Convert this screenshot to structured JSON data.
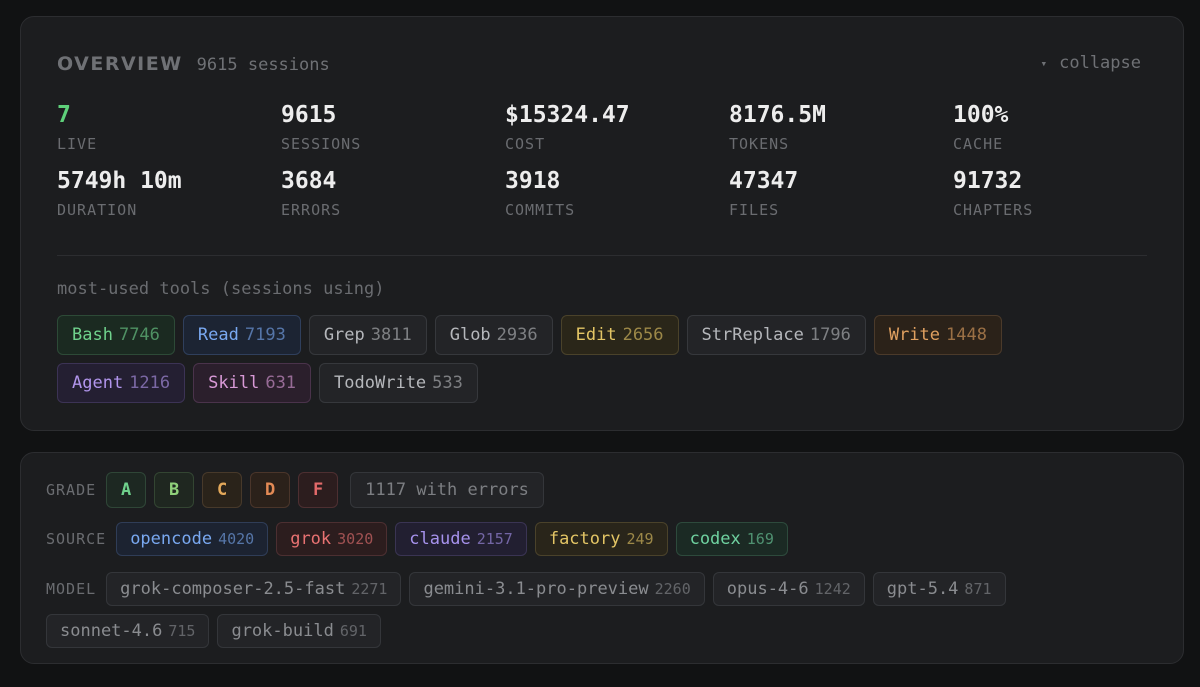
{
  "overview": {
    "title": "OVERVIEW",
    "session_count": "9615 sessions",
    "collapse_label": "collapse",
    "collapse_icon": "triangle-down-icon",
    "stats": [
      {
        "value": "7",
        "label": "LIVE",
        "color": "#5ed07a"
      },
      {
        "value": "9615",
        "label": "SESSIONS"
      },
      {
        "value": "$15324.47",
        "label": "COST"
      },
      {
        "value": "8176.5M",
        "label": "TOKENS"
      },
      {
        "value": "100%",
        "label": "CACHE"
      },
      {
        "value": "5749h 10m",
        "label": "DURATION"
      },
      {
        "value": "3684",
        "label": "ERRORS"
      },
      {
        "value": "3918",
        "label": "COMMITS"
      },
      {
        "value": "47347",
        "label": "FILES"
      },
      {
        "value": "91732",
        "label": "CHAPTERS"
      }
    ],
    "tools_label": "most-used tools (sessions using)",
    "tools": [
      {
        "name": "Bash",
        "count": "7746",
        "color": "#6fd18c",
        "bg": "#1b2a21",
        "border": "#2d4a37"
      },
      {
        "name": "Read",
        "count": "7193",
        "color": "#79a8f0",
        "bg": "#1c2433",
        "border": "#2f3f5c"
      },
      {
        "name": "Grep",
        "count": "3811",
        "color": "#b5b7bb",
        "bg": "#232427",
        "border": "#36383c"
      },
      {
        "name": "Glob",
        "count": "2936",
        "color": "#b5b7bb",
        "bg": "#232427",
        "border": "#36383c"
      },
      {
        "name": "Edit",
        "count": "2656",
        "color": "#e3c565",
        "bg": "#2a2619",
        "border": "#4a422a"
      },
      {
        "name": "StrReplace",
        "count": "1796",
        "color": "#b5b7bb",
        "bg": "#232427",
        "border": "#36383c"
      },
      {
        "name": "Write",
        "count": "1448",
        "color": "#e0a060",
        "bg": "#2b2219",
        "border": "#4b3a2a"
      },
      {
        "name": "Agent",
        "count": "1216",
        "color": "#b195ec",
        "bg": "#241f32",
        "border": "#3c3355"
      },
      {
        "name": "Skill",
        "count": "631",
        "color": "#d99ad7",
        "bg": "#2b1f2c",
        "border": "#4a334b"
      },
      {
        "name": "TodoWrite",
        "count": "533",
        "color": "#b5b7bb",
        "bg": "#232427",
        "border": "#36383c"
      }
    ]
  },
  "filters": {
    "grade_label": "GRADE",
    "grades": [
      {
        "letter": "A",
        "color": "#6fd18c",
        "bg": "#1d2822",
        "border": "#2f4637"
      },
      {
        "letter": "B",
        "color": "#8fd07a",
        "bg": "#1f2720",
        "border": "#334532"
      },
      {
        "letter": "C",
        "color": "#e3a85a",
        "bg": "#2a231a",
        "border": "#47392a"
      },
      {
        "letter": "D",
        "color": "#e38a55",
        "bg": "#2b211a",
        "border": "#4a352a"
      },
      {
        "letter": "F",
        "color": "#e36a6a",
        "bg": "#2c1d1e",
        "border": "#4d2f31"
      }
    ],
    "errors_chip": "1117 with errors",
    "source_label": "SOURCE",
    "sources": [
      {
        "name": "opencode",
        "count": "4020",
        "color": "#79a8f0",
        "bg": "#1c2331",
        "border": "#2f3d57"
      },
      {
        "name": "grok",
        "count": "3020",
        "color": "#e87272",
        "bg": "#2c1d1e",
        "border": "#4c2f31"
      },
      {
        "name": "claude",
        "count": "2157",
        "color": "#a692ec",
        "bg": "#221f31",
        "border": "#3a3453"
      },
      {
        "name": "factory",
        "count": "249",
        "color": "#e3c565",
        "bg": "#29251a",
        "border": "#4a422a"
      },
      {
        "name": "codex",
        "count": "169",
        "color": "#6fd1a0",
        "bg": "#1b2a24",
        "border": "#2d4a3c"
      }
    ],
    "model_label": "MODEL",
    "models": [
      {
        "name": "grok-composer-2.5-fast",
        "count": "2271"
      },
      {
        "name": "gemini-3.1-pro-preview",
        "count": "2260"
      },
      {
        "name": "opus-4-6",
        "count": "1242"
      },
      {
        "name": "gpt-5.4",
        "count": "871"
      },
      {
        "name": "sonnet-4.6",
        "count": "715"
      },
      {
        "name": "grok-build",
        "count": "691"
      }
    ]
  }
}
